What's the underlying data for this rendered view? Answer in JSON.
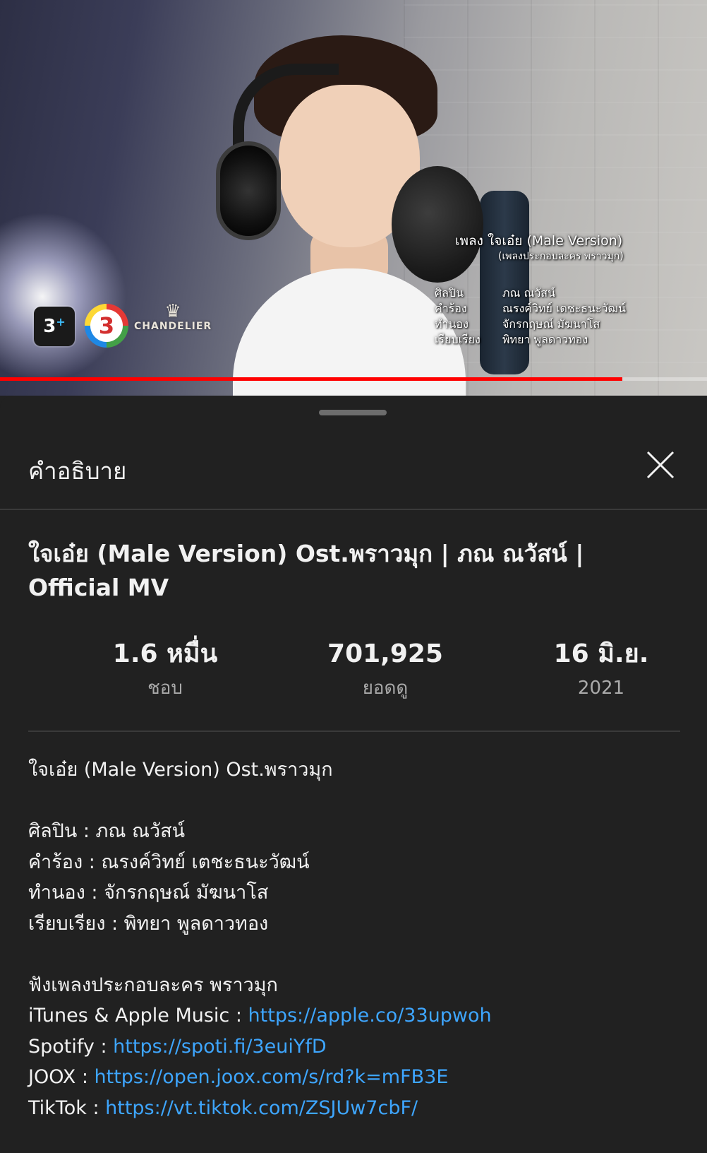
{
  "video": {
    "overlay_song_title": "เพลง ใจเอ๋ย (Male Version)",
    "overlay_song_subtitle": "(เพลงประกอบละคร พราวมุก)",
    "credits": [
      {
        "role": "ศิลปิน",
        "name": "ภณ ณวัสน์"
      },
      {
        "role": "คำร้อง",
        "name": "ณรงค์วิทย์ เตชะธนะวัฒน์"
      },
      {
        "role": "ทำนอง",
        "name": "จักรกฤษณ์ มัฆนาโส"
      },
      {
        "role": "เรียบเรียง",
        "name": "พิทยา พูลดาวทอง"
      }
    ],
    "logo_3plus": "3",
    "logo_3plus_mark": "+",
    "logo_ch3": "3",
    "logo_chandelier": "CHANDELIER",
    "progress": 0.88,
    "progress_color": "#ff0000"
  },
  "sheet": {
    "title": "คำอธิบาย",
    "close_icon": "close-icon"
  },
  "details": {
    "video_title": "ใจเอ๋ย (Male Version) Ost.พราวมุก  | ภณ ณวัสน์  | Official MV",
    "stats": {
      "likes_value": "1.6 หมื่น",
      "likes_label": "ชอบ",
      "views_value": "701,925",
      "views_label": "ยอดดู",
      "date_value": "16 มิ.ย.",
      "date_year": "2021"
    }
  },
  "description": {
    "line1": "ใจเอ๋ย (Male Version) Ost.พราวมุก",
    "artist": "ศิลปิน : ภณ ณวัสน์",
    "lyrics": "คำร้อง : ณรงค์วิทย์ เตชะธนะวัฒน์",
    "melody": "ทำนอง : จักรกฤษณ์ มัฆนาโส",
    "arrange": "เรียบเรียง : พิทยา พูลดาวทอง",
    "listen": "ฟังเพลงประกอบละคร พราวมุก",
    "links": [
      {
        "label": "iTunes & Apple Music : ",
        "url": "https://apple.co/33upwoh"
      },
      {
        "label": "Spotify : ",
        "url": "https://spoti.fi/3euiYfD"
      },
      {
        "label": "JOOX : ",
        "url": "https://open.joox.com/s/rd?k=mFB3E"
      },
      {
        "label": "TikTok : ",
        "url": "https://vt.tiktok.com/ZSJUw7cbF/"
      }
    ],
    "link_color": "#3ea6ff"
  }
}
